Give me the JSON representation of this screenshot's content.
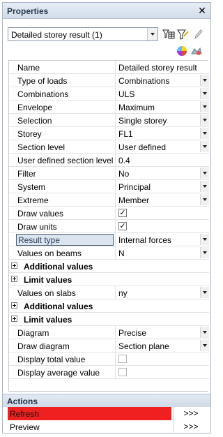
{
  "panel": {
    "title": "Properties",
    "close_glyph": "✕"
  },
  "selector": {
    "value": "Detailed storey result (1)"
  },
  "toolbar": [
    "filter-table-icon",
    "filter-icon",
    "pencil-icon",
    "color-palette-icon",
    "select-model-icon"
  ],
  "rows": [
    {
      "label": "Name",
      "value": "Detailed storey result",
      "kind": "text"
    },
    {
      "label": "Type of loads",
      "value": "Combinations",
      "kind": "select"
    },
    {
      "label": "Combinations",
      "value": "ULS",
      "kind": "select"
    },
    {
      "label": "Envelope",
      "value": "Maximum",
      "kind": "select"
    },
    {
      "label": "Selection",
      "value": "Single storey",
      "kind": "select"
    },
    {
      "label": "Storey",
      "value": "FL1",
      "kind": "select"
    },
    {
      "label": "Section level",
      "value": "User defined",
      "kind": "select"
    },
    {
      "label": "User defined section level",
      "value": "0.4",
      "kind": "text"
    },
    {
      "label": "Filter",
      "value": "No",
      "kind": "select"
    },
    {
      "label": "System",
      "value": "Principal",
      "kind": "select"
    },
    {
      "label": "Extreme",
      "value": "Member",
      "kind": "select"
    },
    {
      "label": "Draw values",
      "value": "✓",
      "kind": "check_on"
    },
    {
      "label": "Draw units",
      "value": "✓",
      "kind": "check_on"
    },
    {
      "label": "Result type",
      "value": "Internal forces",
      "kind": "select",
      "selected": true
    },
    {
      "label": "Values on beams",
      "value": "N",
      "kind": "select"
    },
    {
      "label": "Additional values",
      "kind": "group"
    },
    {
      "label": "Limit values",
      "kind": "group"
    },
    {
      "label": "Values on slabs",
      "value": "ny",
      "kind": "select"
    },
    {
      "label": "Additional values",
      "kind": "group"
    },
    {
      "label": "Limit values",
      "kind": "group"
    },
    {
      "label": "Diagram",
      "value": "Precise",
      "kind": "select"
    },
    {
      "label": "Draw diagram",
      "value": "Section plane",
      "kind": "select"
    },
    {
      "label": "Display total value",
      "value": "",
      "kind": "check_off"
    },
    {
      "label": "Display average value",
      "value": "",
      "kind": "check_off"
    }
  ],
  "actions": {
    "header": "Actions",
    "items": [
      {
        "label": "Refresh",
        "button": ">>>",
        "highlight": "#f02020"
      },
      {
        "label": "Preview",
        "button": ">>>"
      }
    ]
  }
}
